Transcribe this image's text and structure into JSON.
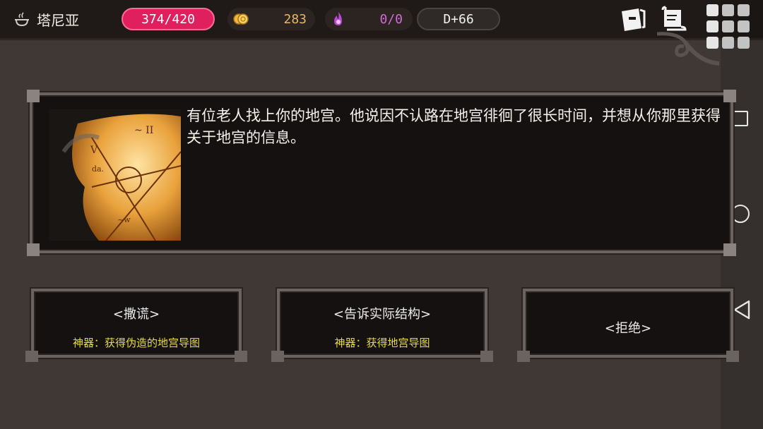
{
  "topbar": {
    "title": "塔尼亚",
    "hp": "374/420",
    "gold": "283",
    "soul": "0/0",
    "day": "D+66"
  },
  "event": {
    "description": "有位老人找上你的地宫。他说因不认路在地宫徘徊了很长时间，并想从你那里获得关于地宫的信息。"
  },
  "choices": [
    {
      "label": "<撒谎>",
      "effect": "神器：获得伪造的地宫导图"
    },
    {
      "label": "<告诉实际结构>",
      "effect": "神器：获得地宫导图"
    },
    {
      "label": "<拒绝>",
      "effect": ""
    }
  ],
  "colors": {
    "hp_bar": "#e01f5e",
    "gold_text": "#e8b56c",
    "soul_text": "#d46ad8",
    "effect_text": "#e6dc3a",
    "background": "#3f3835"
  },
  "icons": {
    "title": "cauldron-icon",
    "gold": "coins-icon",
    "soul": "purple-flame-icon",
    "quest": "quest-card-icon",
    "journal": "scroll-icon",
    "menu": "grid-menu-icon"
  }
}
